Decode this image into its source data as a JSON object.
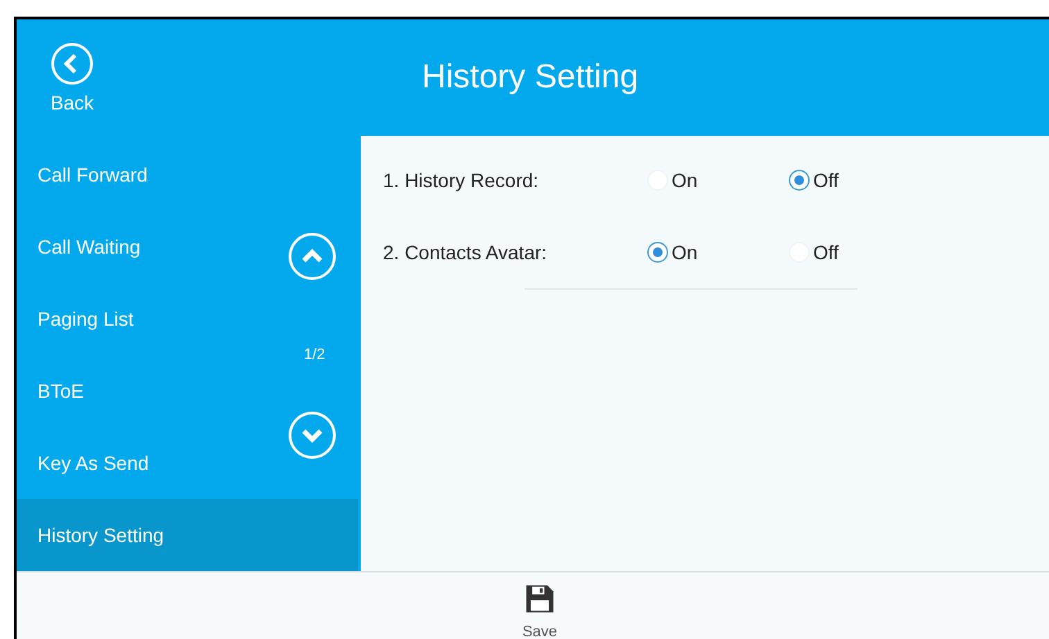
{
  "header": {
    "back_label": "Back",
    "title": "History Setting"
  },
  "sidebar": {
    "items": [
      {
        "label": "Call Forward",
        "selected": false
      },
      {
        "label": "Call Waiting",
        "selected": false
      },
      {
        "label": "Paging List",
        "selected": false
      },
      {
        "label": "BToE",
        "selected": false
      },
      {
        "label": "Key As Send",
        "selected": false
      },
      {
        "label": "History Setting",
        "selected": true
      }
    ],
    "page_indicator": "1/2"
  },
  "settings": [
    {
      "label": "1. History Record:",
      "options": [
        {
          "label": "On",
          "selected": false
        },
        {
          "label": "Off",
          "selected": true
        }
      ]
    },
    {
      "label": "2. Contacts Avatar:",
      "options": [
        {
          "label": "On",
          "selected": true
        },
        {
          "label": "Off",
          "selected": false
        }
      ]
    }
  ],
  "softkeys": [
    {
      "label": "Save"
    }
  ]
}
